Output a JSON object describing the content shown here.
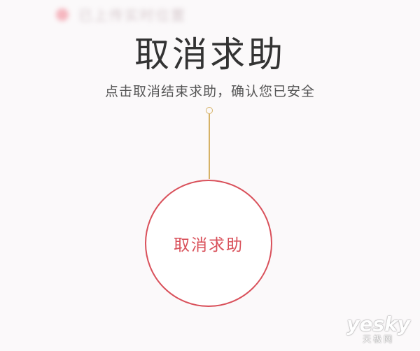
{
  "status_bar": {
    "text": "已上传实时位置",
    "dot_color": "#f3a0ab"
  },
  "main": {
    "title": "取消求助",
    "subtitle": "点击取消结束求助，确认您已安全"
  },
  "cancel_button": {
    "label": "取消求助",
    "accent_color": "#d9505a"
  },
  "connector": {
    "color": "#d6b266"
  },
  "watermark": {
    "main": "yesky",
    "sub": "天极网"
  }
}
